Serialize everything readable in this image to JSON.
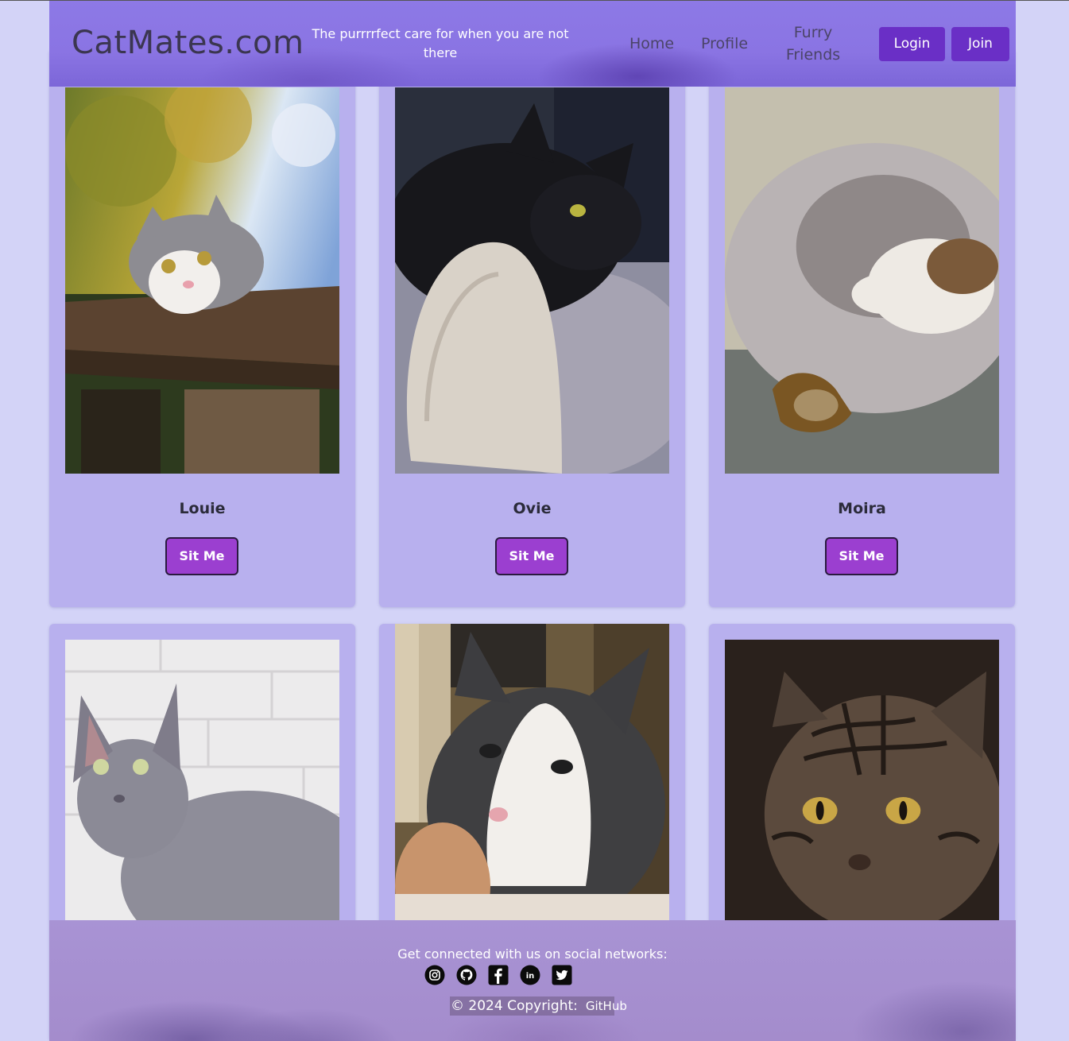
{
  "nav": {
    "brand": "CatMates.com",
    "tagline": "The purrrrfect care for when you are not there",
    "links": [
      "Home",
      "Profile",
      "Furry Friends"
    ],
    "login": "Login",
    "join": "Join"
  },
  "cats": [
    {
      "name": "Louie",
      "button": "Sit Me",
      "photo": "grey-white-cat-on-wooden-beam-icon"
    },
    {
      "name": "Ovie",
      "button": "Sit Me",
      "photo": "black-cat-on-cat-tree-icon"
    },
    {
      "name": "Moira",
      "button": "Sit Me",
      "photo": "calico-cat-in-fluffy-bed-icon"
    },
    {
      "name": "",
      "button": "",
      "photo": "sphynx-cat-icon"
    },
    {
      "name": "",
      "button": "",
      "photo": "grey-white-cat-closeup-icon"
    },
    {
      "name": "",
      "button": "",
      "photo": "tabby-cat-closeup-icon"
    }
  ],
  "footer": {
    "connect": "Get connected with us on social networks:",
    "socials": [
      "instagram-icon",
      "github-icon",
      "facebook-icon",
      "linkedin-icon",
      "twitter-icon"
    ],
    "copyright": "© 2024 Copyright:",
    "github_link": "GitHub"
  },
  "colors": {
    "page_bg": "#d3d3f7",
    "navbar": "#8a74e3",
    "card_bg": "#b8b0ee",
    "nav_button": "#6a2fc6",
    "sit_button": "#9b3fd0"
  }
}
